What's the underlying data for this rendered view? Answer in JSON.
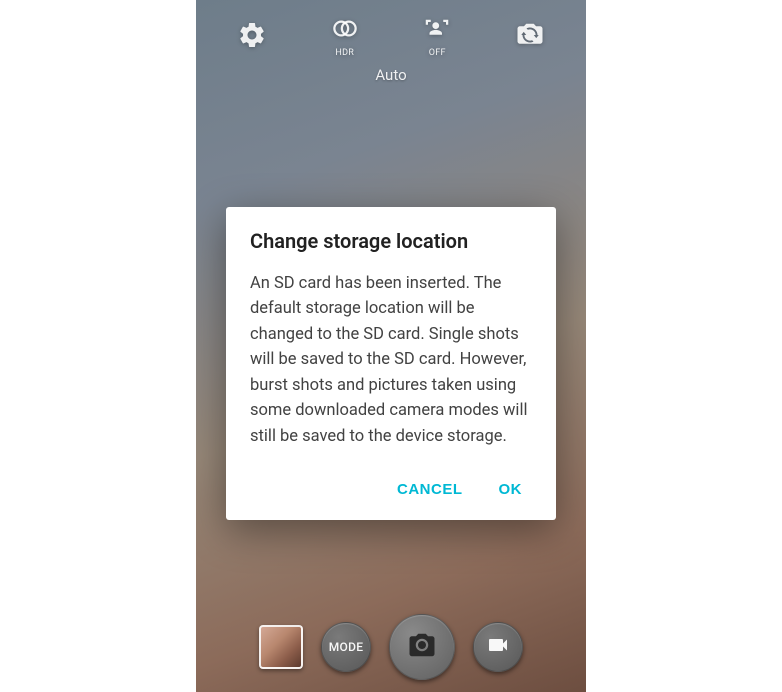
{
  "topbar": {
    "hdr_label": "HDR",
    "flash_off_label": "OFF"
  },
  "camera_mode": "Auto",
  "bottombar": {
    "mode_label": "MODE"
  },
  "dialog": {
    "title": "Change storage location",
    "body": "An SD card has been inserted. The default storage location will be changed to the SD card. Single shots will be saved to the SD card. However, burst shots and pictures taken using some downloaded camera modes will still be saved to the device storage.",
    "cancel_label": "CANCEL",
    "ok_label": "OK"
  }
}
